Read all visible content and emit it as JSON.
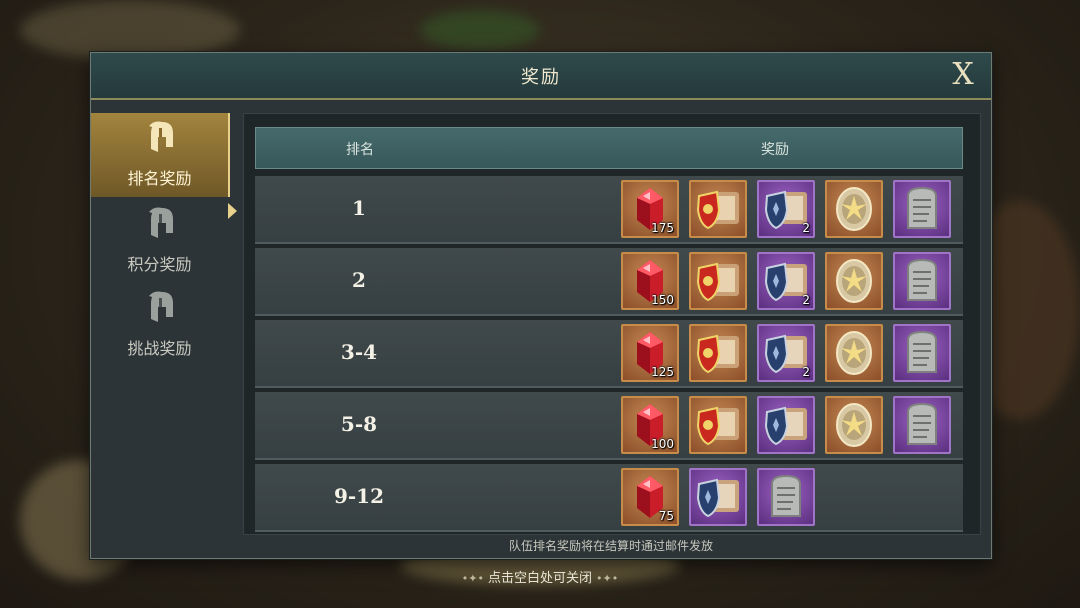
{
  "dialog": {
    "title": "奖励",
    "close_label": "X"
  },
  "sidebar": {
    "tabs": [
      {
        "label": "排名奖励",
        "active": true
      },
      {
        "label": "积分奖励",
        "active": false
      },
      {
        "label": "挑战奖励",
        "active": false
      }
    ]
  },
  "table": {
    "headers": {
      "rank": "排名",
      "reward": "奖励"
    },
    "rows": [
      {
        "rank": "1",
        "rewards": [
          {
            "icon": "red-gem-icon",
            "frame": "orange",
            "qty": "175"
          },
          {
            "icon": "red-shield-chest-icon",
            "frame": "orange",
            "qty": ""
          },
          {
            "icon": "blue-shield-chest-icon",
            "frame": "purple",
            "qty": "2"
          },
          {
            "icon": "golden-emblem-icon",
            "frame": "orange",
            "qty": ""
          },
          {
            "icon": "stone-tablet-icon",
            "frame": "purple",
            "qty": ""
          }
        ]
      },
      {
        "rank": "2",
        "rewards": [
          {
            "icon": "red-gem-icon",
            "frame": "orange",
            "qty": "150"
          },
          {
            "icon": "red-shield-chest-icon",
            "frame": "orange",
            "qty": ""
          },
          {
            "icon": "blue-shield-chest-icon",
            "frame": "purple",
            "qty": "2"
          },
          {
            "icon": "golden-emblem-icon",
            "frame": "orange",
            "qty": ""
          },
          {
            "icon": "stone-tablet-icon",
            "frame": "purple",
            "qty": ""
          }
        ]
      },
      {
        "rank": "3-4",
        "rewards": [
          {
            "icon": "red-gem-icon",
            "frame": "orange",
            "qty": "125"
          },
          {
            "icon": "red-shield-chest-icon",
            "frame": "orange",
            "qty": ""
          },
          {
            "icon": "blue-shield-chest-icon",
            "frame": "purple",
            "qty": "2"
          },
          {
            "icon": "golden-emblem-icon",
            "frame": "orange",
            "qty": ""
          },
          {
            "icon": "stone-tablet-icon",
            "frame": "purple",
            "qty": ""
          }
        ]
      },
      {
        "rank": "5-8",
        "rewards": [
          {
            "icon": "red-gem-icon",
            "frame": "orange",
            "qty": "100"
          },
          {
            "icon": "red-shield-chest-icon",
            "frame": "orange",
            "qty": ""
          },
          {
            "icon": "blue-shield-chest-icon",
            "frame": "purple",
            "qty": ""
          },
          {
            "icon": "golden-emblem-icon",
            "frame": "orange",
            "qty": ""
          },
          {
            "icon": "stone-tablet-icon",
            "frame": "purple",
            "qty": ""
          }
        ]
      },
      {
        "rank": "9-12",
        "rewards": [
          {
            "icon": "red-gem-icon",
            "frame": "orange",
            "qty": "75"
          },
          {
            "icon": "blue-shield-chest-icon",
            "frame": "purple",
            "qty": ""
          },
          {
            "icon": "stone-tablet-icon",
            "frame": "purple",
            "qty": ""
          }
        ]
      }
    ]
  },
  "footer": {
    "note": "队伍排名奖励将在结算时通过邮件发放",
    "close_hint": "点击空白处可关闭"
  },
  "colors": {
    "accent_gold": "#e8d18a",
    "frame_orange": "#c78c4a",
    "frame_purple": "#a074c6"
  }
}
